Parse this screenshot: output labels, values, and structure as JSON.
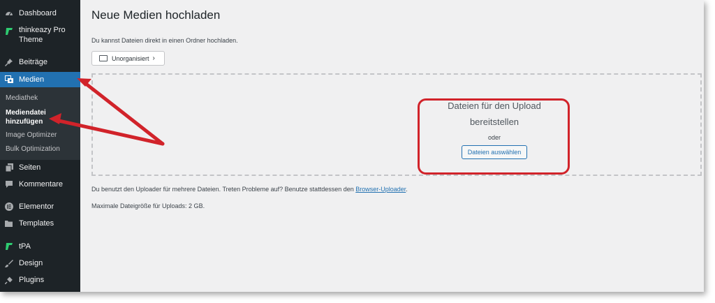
{
  "sidebar": {
    "items": [
      {
        "label": "Dashboard",
        "icon": "dashboard-icon"
      },
      {
        "label": "thinkeazy Pro Theme",
        "icon": "theme-logo-icon"
      },
      {
        "label": "Beiträge",
        "icon": "pin-icon"
      },
      {
        "label": "Medien",
        "icon": "media-icon",
        "active": true
      },
      {
        "label": "Seiten",
        "icon": "pages-icon"
      },
      {
        "label": "Kommentare",
        "icon": "comments-icon"
      },
      {
        "label": "Elementor",
        "icon": "elementor-icon"
      },
      {
        "label": "Templates",
        "icon": "folder-icon"
      },
      {
        "label": "tPA",
        "icon": "tpa-logo-icon"
      },
      {
        "label": "Design",
        "icon": "brush-icon"
      },
      {
        "label": "Plugins",
        "icon": "plugin-icon"
      }
    ],
    "submenu": [
      {
        "label": "Mediathek"
      },
      {
        "label": "Mediendatei hinzufügen",
        "current": true
      },
      {
        "label": "Image Optimizer"
      },
      {
        "label": "Bulk Optimization"
      }
    ]
  },
  "main": {
    "title": "Neue Medien hochladen",
    "intro": "Du kannst Dateien direkt in einen Ordner hochladen.",
    "folder_label": "Unorganisiert",
    "dropzone": {
      "title_line1": "Dateien für den Upload",
      "title_line2": "bereitstellen",
      "or": "oder",
      "button": "Dateien auswählen"
    },
    "uploader_note_prefix": "Du benutzt den Uploader für mehrere Dateien. Treten Probleme auf? Benutze stattdessen den ",
    "uploader_note_link": "Browser-Uploader",
    "uploader_note_suffix": ".",
    "max_size": "Maximale Dateigröße für Uploads: 2 GB."
  },
  "colors": {
    "sidebar_bg": "#1d2327",
    "active_bg": "#2271b1",
    "annotation_red": "#d1232a",
    "link": "#2271b1"
  }
}
